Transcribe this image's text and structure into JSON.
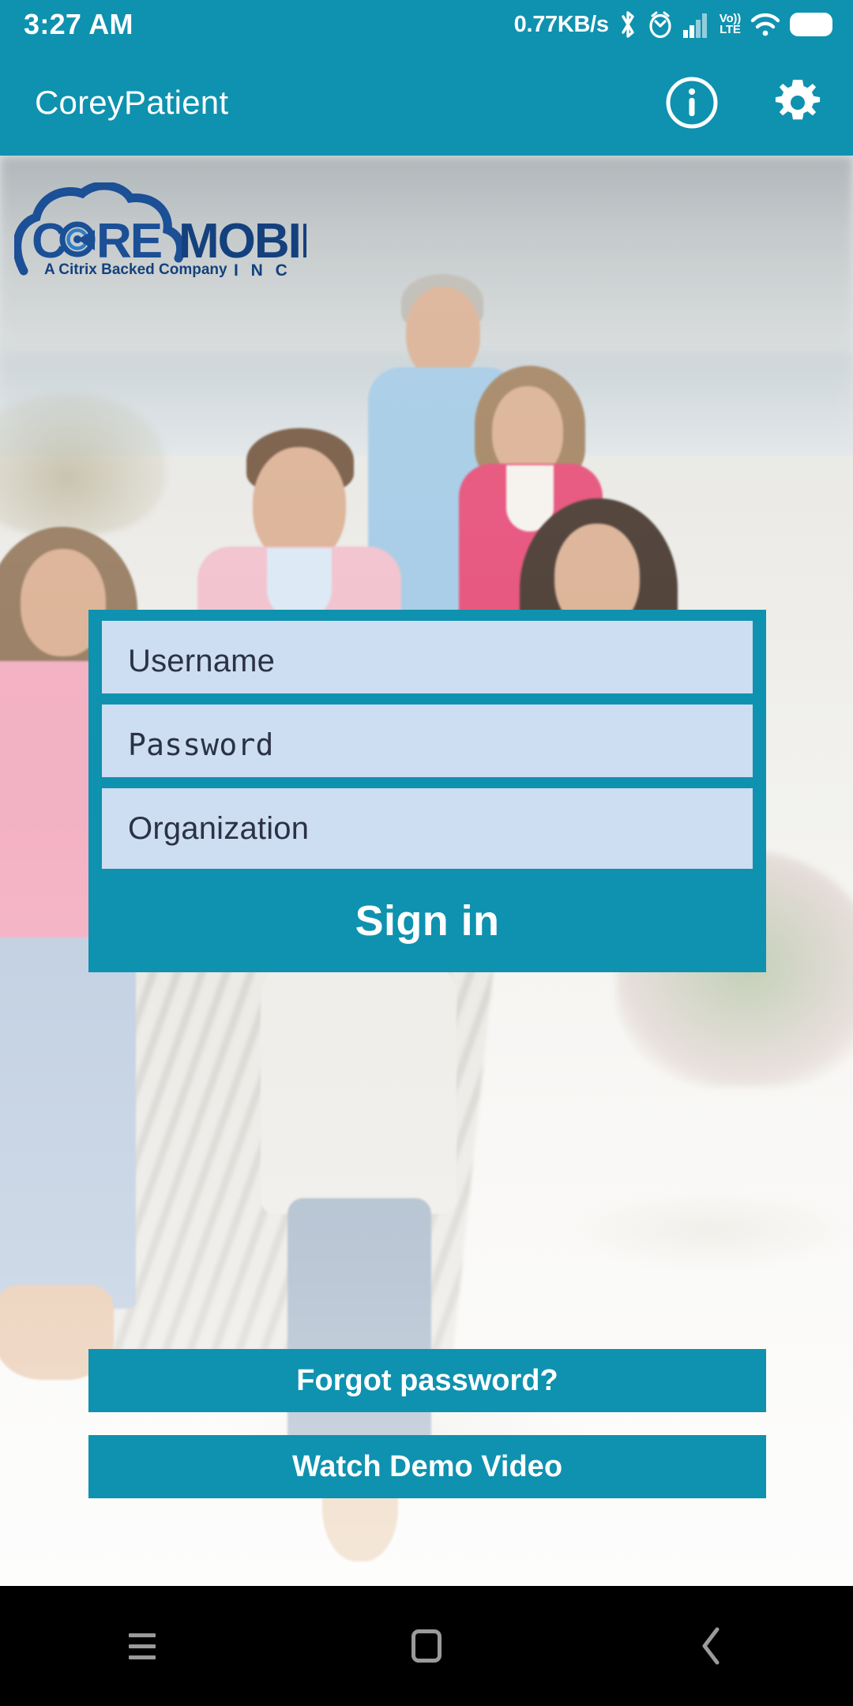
{
  "status_bar": {
    "time": "3:27 AM",
    "network_speed": "0.77KB/s",
    "volte_top": "Vo))",
    "volte_bottom": "LTE",
    "icons": [
      "bluetooth-icon",
      "alarm-icon",
      "cellular-signal-icon",
      "volte-icon",
      "wifi-icon",
      "battery-icon"
    ]
  },
  "app_bar": {
    "title": "CoreyPatient",
    "info_label": "i",
    "icons": [
      "info-icon",
      "gear-icon"
    ]
  },
  "logo": {
    "word_core": "C",
    "word_core_rest": "RE",
    "word_mobile": "MOBILE",
    "word_inc": "I N C",
    "tagline": "A Citrix Backed Company"
  },
  "form": {
    "username": {
      "value": "",
      "placeholder": "Username"
    },
    "password": {
      "value": "",
      "placeholder": "Password"
    },
    "organization": {
      "value": "",
      "placeholder": "Organization"
    },
    "sign_in_label": "Sign in"
  },
  "links": {
    "forgot_password_label": "Forgot password?",
    "watch_demo_label": "Watch Demo Video"
  },
  "nav_bar": {
    "recents_label": "recents-icon",
    "home_label": "home-icon",
    "back_label": "back-icon"
  },
  "colors": {
    "brand_teal": "#0e92af",
    "field_fill": "#cdddf2",
    "placeholder_text": "#2b3245",
    "logo_blue": "#1b4f96",
    "nav_icon": "#9a9a9a"
  }
}
